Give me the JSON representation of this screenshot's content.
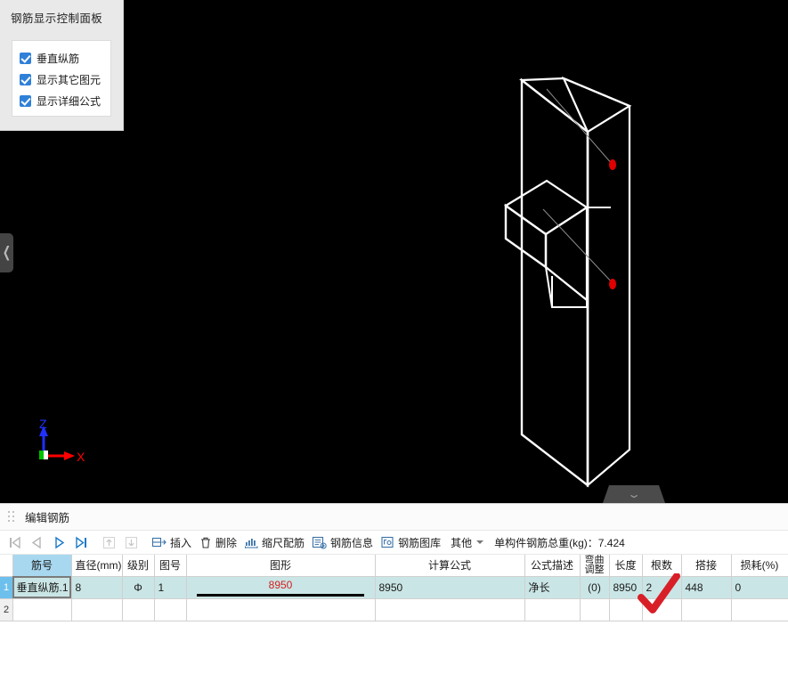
{
  "control_panel": {
    "title": "钢筋显示控制面板",
    "checkboxes": [
      {
        "label": "垂直纵筋",
        "checked": true,
        "icon": "checkbox-checked-icon"
      },
      {
        "label": "显示其它图元",
        "checked": true,
        "icon": "checkbox-checked-icon"
      },
      {
        "label": "显示详细公式",
        "checked": true,
        "icon": "checkbox-checked-icon"
      }
    ]
  },
  "viewport": {
    "background": "#000000",
    "axis": {
      "z_label": "Z",
      "x_label": "X",
      "z_color": "#2030ff",
      "x_color": "#ff0000",
      "origin_color": "#00c000"
    },
    "markers": [
      {
        "name": "rebar-endpoint-top",
        "color": "#e00000"
      },
      {
        "name": "rebar-endpoint-bottom",
        "color": "#e00000"
      }
    ],
    "left_tab_icon": "chevron-left-icon",
    "bottom_handle_icon": "chevron-down-icon"
  },
  "bottom_pane": {
    "title": "编辑钢筋",
    "grip_icon": "drag-grip-icon",
    "toolbar": {
      "nav": [
        {
          "name": "first-record-button",
          "icon": "first-record-icon",
          "enabled": false
        },
        {
          "name": "prev-record-button",
          "icon": "prev-record-icon",
          "enabled": false
        },
        {
          "name": "next-record-button",
          "icon": "next-record-icon",
          "enabled": true
        },
        {
          "name": "last-record-button",
          "icon": "last-record-icon",
          "enabled": true
        },
        {
          "name": "move-up-button",
          "icon": "arrow-up-icon",
          "enabled": false
        },
        {
          "name": "move-down-button",
          "icon": "arrow-down-icon",
          "enabled": false
        }
      ],
      "buttons": [
        {
          "label": "插入",
          "icon": "insert-row-icon"
        },
        {
          "label": "删除",
          "icon": "trash-icon"
        },
        {
          "label": "缩尺配筋",
          "icon": "scale-rebar-icon"
        },
        {
          "label": "钢筋信息",
          "icon": "rebar-info-icon"
        },
        {
          "label": "钢筋图库",
          "icon": "rebar-library-icon"
        },
        {
          "label": "其他",
          "icon": "chevron-down-icon",
          "has_caret": true
        }
      ],
      "total_weight": "单构件钢筋总重(kg)：7.424"
    },
    "table": {
      "columns": [
        "筋号",
        "直径(mm)",
        "级别",
        "图号",
        "图形",
        "计算公式",
        "公式描述",
        "弯曲调整",
        "长度",
        "根数",
        "搭接",
        "损耗(%)"
      ],
      "selected_column": "筋号",
      "rows": [
        {
          "index": "1",
          "selected": true,
          "筋号": "垂直纵筋.1",
          "直径(mm)": "8",
          "级别": "Φ",
          "图号": "1",
          "图形": "8950",
          "计算公式": "8950",
          "公式描述": "净长",
          "弯曲调整": "(0)",
          "长度": "8950",
          "根数": "2",
          "搭接": "448",
          "损耗(%)": "0"
        },
        {
          "index": "2",
          "selected": false,
          "筋号": "",
          "直径(mm)": "",
          "级别": "",
          "图号": "",
          "图形": "",
          "计算公式": "",
          "公式描述": "",
          "弯曲调整": "",
          "长度": "",
          "根数": "",
          "搭接": "",
          "损耗(%)": ""
        }
      ]
    }
  },
  "annotations": [
    {
      "name": "red-check-annotation",
      "shape": "checkmark",
      "color": "#d81f28"
    }
  ]
}
